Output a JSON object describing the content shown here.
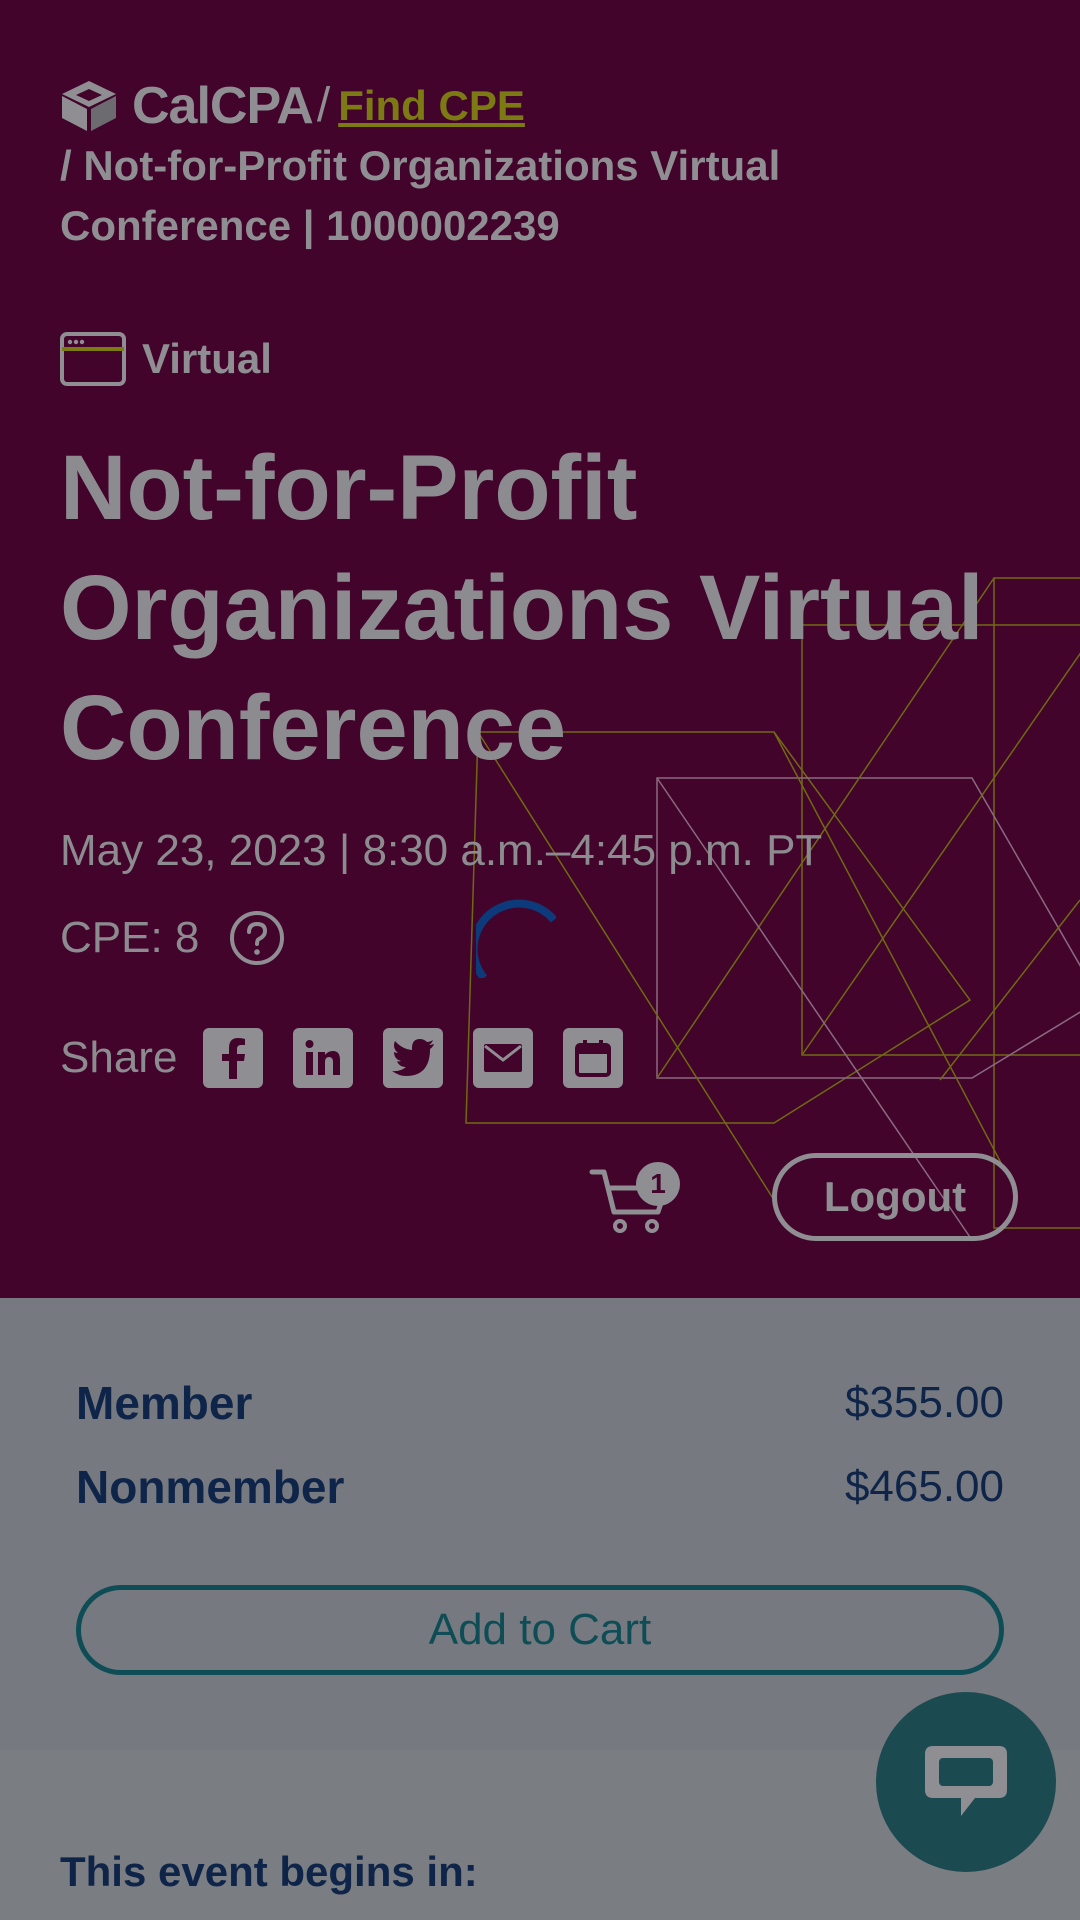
{
  "header": {
    "logo_text": "CalCPA",
    "separator": "/",
    "find_cpe_link": "Find CPE",
    "breadcrumb_rest": "/ Not-for-Profit Organizations Virtual Conference | 1000002239"
  },
  "event": {
    "type_icon": "browser-window-icon",
    "type_label": "Virtual",
    "title": "Not-for-Profit Organizations Virtual Conference",
    "date_time": "May 23, 2023 | 8:30 a.m.–4:45 p.m. PT",
    "cpe": "CPE: 8",
    "help_icon": "question-circle-icon"
  },
  "share": {
    "label": "Share",
    "icons": [
      "facebook-icon",
      "linkedin-icon",
      "twitter-icon",
      "email-icon",
      "calendar-icon"
    ]
  },
  "account": {
    "cart_count": "1",
    "logout_label": "Logout"
  },
  "pricing": {
    "member_label": "Member",
    "member_price": "$355.00",
    "nonmember_label": "Nonmember",
    "nonmember_price": "$465.00",
    "add_to_cart_label": "Add to Cart"
  },
  "countdown": {
    "heading": "This event begins in:"
  },
  "colors": {
    "hero_background": "#42042b",
    "accent_olive": "#7b7a13",
    "navy_text": "#0e2449",
    "teal": "#0f4d56",
    "overlay_gray": "#7a7d82"
  }
}
